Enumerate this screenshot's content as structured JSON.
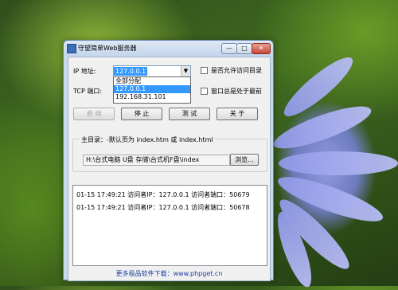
{
  "window": {
    "title": "守望简单Web服务器",
    "minimize_glyph": "—",
    "maximize_glyph": "□",
    "close_glyph": "✕"
  },
  "form": {
    "ip_label": "IP 地址:",
    "ip_value": "127.0.0.1",
    "ip_options": [
      "全部分配",
      "127.0.0.1",
      "192.168.31.101"
    ],
    "ip_selected_index": 1,
    "port_label": "TCP 端口:",
    "allow_browse_label": "是否允许访问目录",
    "always_on_top_label": "窗口总是处于最前"
  },
  "buttons": {
    "start": "启 动",
    "stop": "停 止",
    "test": "测 试",
    "about": "关 于",
    "browse": "浏览..."
  },
  "root": {
    "group_title": "主目录：-默认页为 index.htm 或 index.html",
    "path": "H:\\台式电脑 U盘 存储\\台式机F盘\\index"
  },
  "log": [
    "01-15 17:49:21 访问者IP：127.0.0.1  访问者端口：50679",
    "01-15 17:49:21 访问者IP：127.0.0.1  访问者端口：50678"
  ],
  "footer": "更多极品软件下载：www.phpget.cn",
  "colors": {
    "selection": "#3399ff",
    "titlebar": "#c9d9ee",
    "close_button": "#c9483a"
  }
}
